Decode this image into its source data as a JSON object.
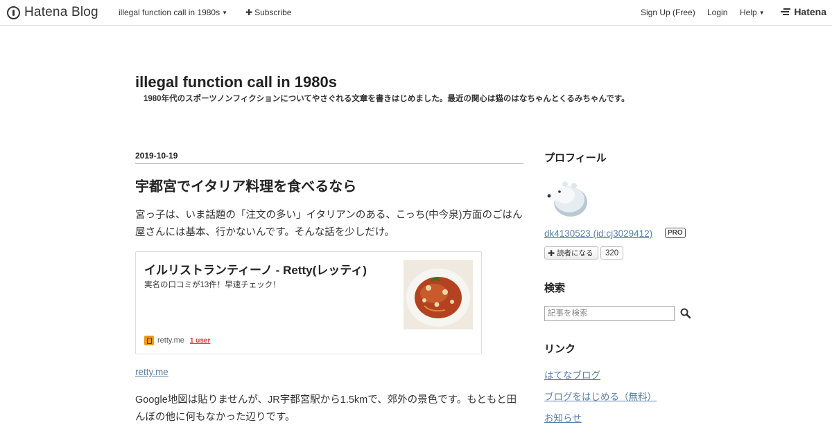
{
  "topbar": {
    "brand": "Hatena Blog",
    "blog_menu": "illegal function call in 1980s",
    "subscribe": "Subscribe",
    "signup": "Sign Up (Free)",
    "login": "Login",
    "help": "Help",
    "hatena": "Hatena"
  },
  "header": {
    "title": "illegal function call in 1980s",
    "description": "1980年代のスポーツノンフィクションについてやさぐれる文章を書きはじめました。最近の関心は猫のはなちゃんとくるみちゃんです。"
  },
  "entry": {
    "date": "2019-10-19",
    "title": "宇都宮でイタリア料理を食べるなら",
    "para1": "宮っ子は、いま話題の「注文の多い」イタリアンのある、こっち(中今泉)方面のごはん屋さんには基本、行かないんです。そんな話を少しだけ。",
    "card": {
      "title": "イルリストランティーノ - Retty(レッティ)",
      "description": "実名の口コミが13件！早速チェック！",
      "site": "retty.me",
      "users": "1 user"
    },
    "link": "retty.me",
    "para2": "Google地図は貼りませんが、JR宇都宮駅から1.5kmで、郊外の景色です。もともと田んぼの他に何もなかった辺りです。"
  },
  "sidebar": {
    "profile_heading": "プロフィール",
    "profile_name": "dk4130523 (id:cj3029412)",
    "pro_badge": "PRO",
    "subscribe_button": "読者になる",
    "subscriber_count": "320",
    "search_heading": "検索",
    "search_placeholder": "記事を検索",
    "links_heading": "リンク",
    "links": [
      "はてなブログ",
      "ブログをはじめる（無料）",
      "お知らせ"
    ]
  }
}
